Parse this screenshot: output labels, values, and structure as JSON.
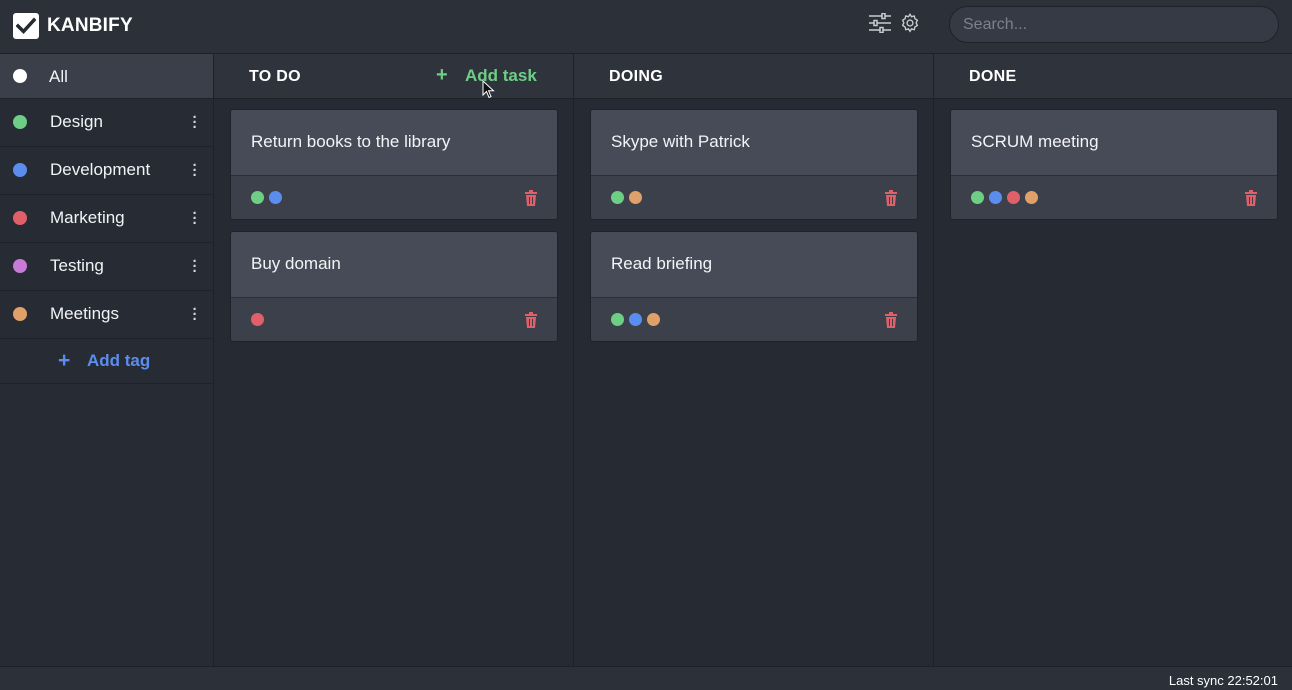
{
  "app": {
    "title": "KANBIFY"
  },
  "search": {
    "placeholder": "Search..."
  },
  "colors": {
    "green": "#6fce86",
    "blue": "#5b8def",
    "red": "#e0606a",
    "purple": "#c97ad9",
    "orange": "#e0a06a",
    "white": "#ffffff"
  },
  "sidebar": {
    "items": [
      {
        "label": "All",
        "color": "#ffffff",
        "active": true
      },
      {
        "label": "Design",
        "color": "#6fce86",
        "menu_icon": "vertical-dots-icon"
      },
      {
        "label": "Development",
        "color": "#5b8def",
        "menu_icon": "vertical-dots-icon"
      },
      {
        "label": "Marketing",
        "color": "#e0606a",
        "menu_icon": "vertical-dots-icon"
      },
      {
        "label": "Testing",
        "color": "#c97ad9",
        "menu_icon": "vertical-dots-icon"
      },
      {
        "label": "Meetings",
        "color": "#e0a06a",
        "menu_icon": "vertical-dots-icon"
      }
    ],
    "add_tag": {
      "plus": "+",
      "label": "Add tag"
    }
  },
  "columns": [
    {
      "title": "TO DO",
      "add_task": {
        "plus": "+",
        "label": "Add task"
      },
      "cards": [
        {
          "title": "Return books to the library",
          "tags": [
            "#6fce86",
            "#5b8def"
          ]
        },
        {
          "title": "Buy domain",
          "tags": [
            "#e0606a"
          ]
        }
      ]
    },
    {
      "title": "DOING",
      "cards": [
        {
          "title": "Skype with Patrick",
          "tags": [
            "#6fce86",
            "#e0a06a"
          ]
        },
        {
          "title": "Read briefing",
          "tags": [
            "#6fce86",
            "#5b8def",
            "#e0a06a"
          ]
        }
      ]
    },
    {
      "title": "DONE",
      "cards": [
        {
          "title": "SCRUM meeting",
          "tags": [
            "#6fce86",
            "#5b8def",
            "#e0606a",
            "#e0a06a"
          ]
        }
      ]
    }
  ],
  "footer": {
    "sync": "Last sync 22:52:01"
  },
  "icons": [
    "check-logo-icon",
    "filter-sliders-icon",
    "gear-icon",
    "trash-icon",
    "vertical-dots-icon",
    "plus-icon",
    "mouse-cursor-icon"
  ]
}
